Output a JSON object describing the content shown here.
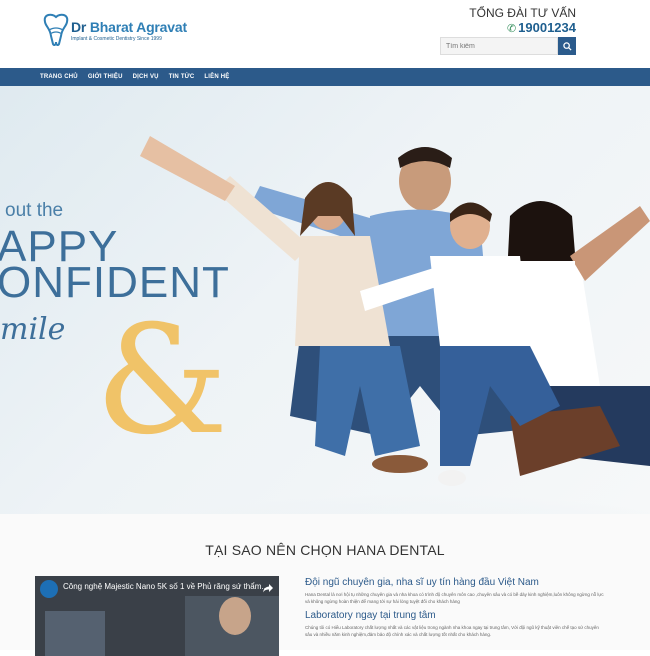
{
  "header": {
    "logo_name_prefix": "Dr ",
    "logo_name": "Bharat Agravat",
    "logo_subtitle": "Implant & Cosmetic Dentistry Since 1999",
    "hotline_label": "TỔNG ĐÀI TƯ VẤN",
    "hotline_number": "19001234",
    "search_placeholder": "Tìm kiếm",
    "icons": {
      "logo": "tooth-logo-icon",
      "phone": "phone-icon",
      "search": "search-icon"
    }
  },
  "nav": {
    "items": [
      "TRANG CHỦ",
      "GIỚI THIỆU",
      "DỊCH VỤ",
      "TIN TỨC",
      "LIÊN HỆ"
    ]
  },
  "hero": {
    "line1": "out the",
    "line2": "APPY",
    "line3": "ONFIDENT",
    "line4": "mile",
    "ampersand": "&",
    "image": "family-photo"
  },
  "why": {
    "title": "TẠI SAO NÊN CHỌN HANA DENTAL",
    "video_title": "Công nghệ Majestic Nano 5K số 1 về Phủ răng sứ thẩm...",
    "features": [
      {
        "title": "Đội ngũ chuyên gia, nha sĩ uy tín hàng đầu Việt Nam",
        "text": "Hana Dental là nơi hội tụ những chuyên gia và nha khoa có trình độ chuyên môn cao ,chuyên sâu và có bề dày kinh nghiệm,luôn không ngừng nỗ lực và không ngừng hoàn thiện để mang tới sự hài lòng tuyệt đối cho khách hàng"
      },
      {
        "title": "Laboratory ngay tại trung tâm",
        "text": "Chúng tôi có Hiểu Laboratory chất lượng nhất và các vật liệu trong ngành nha khoa ngay tại trung tâm, Với đội ngũ kỹ thuật viên chế tạo sứ chuyên sâu và nhiều năm kinh nghiệm,đảm bảo độ chính xác và chất lượng tốt nhất cho khách hàng."
      }
    ]
  },
  "colors": {
    "brand": "#2c5a8a",
    "accent": "#f2b94a"
  }
}
